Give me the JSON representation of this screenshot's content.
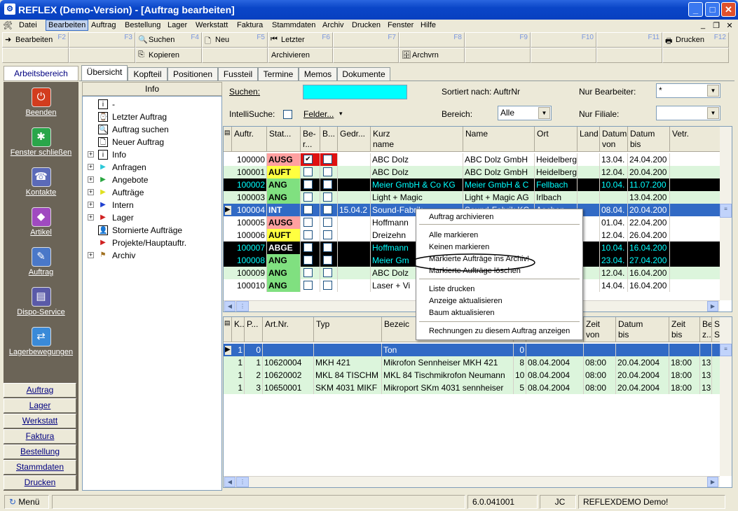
{
  "window": {
    "title": "REFLEX (Demo-Version) - [Auftrag bearbeiten]"
  },
  "menu": [
    "Datei",
    "Bearbeiten",
    "Auftrag",
    "Bestellung",
    "Lager",
    "Werkstatt",
    "Faktura",
    "Stammdaten",
    "Archiv",
    "Drucken",
    "Fenster",
    "Hilfe"
  ],
  "toolbar": {
    "row1": [
      {
        "label": "Bearbeiten",
        "key": "F2"
      },
      {
        "label": "",
        "key": "F3"
      },
      {
        "label": "Suchen",
        "key": "F4"
      },
      {
        "label": "Neu",
        "key": "F5"
      },
      {
        "label": "Letzter",
        "key": "F6"
      },
      {
        "label": "",
        "key": "F7"
      },
      {
        "label": "",
        "key": "F8"
      },
      {
        "label": "",
        "key": "F9"
      },
      {
        "label": "",
        "key": "F10"
      },
      {
        "label": "",
        "key": "F11"
      },
      {
        "label": "Drucken",
        "key": "F12"
      }
    ],
    "row2": [
      "Kopieren",
      "Archivieren",
      "Archvrn"
    ]
  },
  "sidebar": {
    "header": "Arbeitsbereich",
    "items": [
      "Beenden",
      "Fenster schließen",
      "Kontakte",
      "Artikel",
      "Auftrag",
      "Dispo-Service",
      "Lagerbewegungen"
    ],
    "buttons": [
      "Auftrag",
      "Lager",
      "Werkstatt",
      "Faktura",
      "Bestellung",
      "Stammdaten",
      "Drucken"
    ]
  },
  "tabs": [
    "Übersicht",
    "Kopfteil",
    "Positionen",
    "Fussteil",
    "Termine",
    "Memos",
    "Dokumente"
  ],
  "tree": {
    "header": "Info",
    "items": [
      {
        "label": "-",
        "exp": false
      },
      {
        "label": "Letzter Auftrag",
        "exp": false
      },
      {
        "label": "Auftrag suchen",
        "exp": false
      },
      {
        "label": "Neuer Auftrag",
        "exp": false
      },
      {
        "label": "Info",
        "exp": true
      },
      {
        "label": "Anfragen",
        "exp": true
      },
      {
        "label": "Angebote",
        "exp": true
      },
      {
        "label": "Aufträge",
        "exp": true
      },
      {
        "label": "Intern",
        "exp": true
      },
      {
        "label": "Lager",
        "exp": true
      },
      {
        "label": "Stornierte Aufträge",
        "exp": false
      },
      {
        "label": "Projekte/Hauptauftr.",
        "exp": false
      },
      {
        "label": "Archiv",
        "exp": true
      }
    ]
  },
  "search": {
    "suchen": "Suchen:",
    "intelli": "IntelliSuche:",
    "felder": "Felder...",
    "sortiert": "Sortiert nach: AuftrNr",
    "bereich": "Bereich:",
    "bereich_value": "Alle",
    "nur_bearbeiter": "Nur Bearbeiter:",
    "bearbeiter_value": "*",
    "nur_filiale": "Nur Filiale:"
  },
  "orders": {
    "headers": [
      "Auftr.",
      "Stat...",
      "Be-\nr...",
      "B...",
      "Gedr...",
      "Kurz\nname",
      "Name",
      "Ort",
      "Land",
      "Datum\nvon",
      "Datum\nbis",
      "Vetr."
    ],
    "rows": [
      {
        "nr": "100000",
        "stat": "AUSG",
        "gedr": "",
        "kurz": "ABC Dolz",
        "name": "ABC Dolz GmbH",
        "ort": "Heidelberg",
        "von": "13.04.",
        "bis": "24.04.200",
        "style": "ausg-red",
        "c1": true
      },
      {
        "nr": "100001",
        "stat": "AUFT",
        "gedr": "",
        "kurz": "ABC Dolz",
        "name": "ABC Dolz GmbH",
        "ort": "Heidelberg",
        "von": "12.04.",
        "bis": "20.04.200",
        "style": "green"
      },
      {
        "nr": "100002",
        "stat": "ANG",
        "gedr": "",
        "kurz": "Meier GmbH & Co KG",
        "name": "Meier GmbH & C",
        "ort": "Fellbach",
        "von": "10.04.",
        "bis": "11.07.200",
        "style": "black"
      },
      {
        "nr": "100003",
        "stat": "ANG",
        "gedr": "",
        "kurz": "Light + Magic",
        "name": "Light + Magic AG",
        "ort": "Irlbach",
        "von": "",
        "bis": "13.04.200",
        "style": "green"
      },
      {
        "nr": "100004",
        "stat": "INT",
        "gedr": "15.04.2",
        "kurz": "Sound-Fabrik",
        "name": "Sound-Fabrik KG",
        "ort": "Aachen",
        "von": "08.04.",
        "bis": "20.04.200",
        "style": "selected"
      },
      {
        "nr": "100005",
        "stat": "AUSG",
        "gedr": "",
        "kurz": "Hoffmann",
        "name": "",
        "ort": "",
        "von": "01.04.",
        "bis": "22.04.200",
        "style": "white"
      },
      {
        "nr": "100006",
        "stat": "AUFT",
        "gedr": "",
        "kurz": "Dreizehn",
        "name": "",
        "ort": "",
        "von": "12.04.",
        "bis": "26.04.200",
        "style": "white"
      },
      {
        "nr": "100007",
        "stat": "ABGE",
        "gedr": "",
        "kurz": "Hoffmann",
        "name": "",
        "ort": "",
        "von": "10.04.",
        "bis": "16.04.200",
        "style": "black"
      },
      {
        "nr": "100008",
        "stat": "ANG",
        "gedr": "",
        "kurz": "Meier Gm",
        "name": "",
        "ort": "",
        "von": "23.04.",
        "bis": "27.04.200",
        "style": "black"
      },
      {
        "nr": "100009",
        "stat": "ANG",
        "gedr": "",
        "kurz": "ABC Dolz",
        "name": "",
        "ort": "",
        "von": "12.04.",
        "bis": "16.04.200",
        "style": "green"
      },
      {
        "nr": "100010",
        "stat": "ANG",
        "gedr": "",
        "kurz": "Laser + Vi",
        "name": "",
        "ort": "",
        "von": "14.04.",
        "bis": "16.04.200",
        "style": "white"
      }
    ]
  },
  "positions": {
    "headers": [
      "K...",
      "P...",
      "Art.Nr.",
      "Typ",
      "Bezeic",
      "",
      "Datum\nvon",
      "Zeit\nvon",
      "Datum\nbis",
      "Zeit\nbis",
      "Be\nz...",
      "S\nS"
    ],
    "rows": [
      {
        "k": "1",
        "p": "0",
        "art": "",
        "typ": "",
        "bez": "Ton",
        "qty": "0",
        "dv": "",
        "zv": "",
        "db": "",
        "zb": "",
        "z": "",
        "sel": true
      },
      {
        "k": "1",
        "p": "1",
        "art": "10620004",
        "typ": "MKH 421",
        "bez": "Mikrofon Sennheiser MKH 421",
        "qty": "8",
        "dv": "08.04.2004",
        "zv": "08:00",
        "db": "20.04.2004",
        "zb": "18:00",
        "z": "13"
      },
      {
        "k": "1",
        "p": "2",
        "art": "10620002",
        "typ": "MKL 84 TISCHM",
        "bez": "MKL 84 Tischmikrofon Neumann",
        "qty": "10",
        "dv": "08.04.2004",
        "zv": "08:00",
        "db": "20.04.2004",
        "zb": "18:00",
        "z": "13"
      },
      {
        "k": "1",
        "p": "3",
        "art": "10650001",
        "typ": "SKM 4031 MIKF",
        "bez": "Mikroport SKm 4031 sennheiser",
        "qty": "5",
        "dv": "08.04.2004",
        "zv": "08:00",
        "db": "20.04.2004",
        "zb": "18:00",
        "z": "13"
      }
    ]
  },
  "context_menu": [
    "Auftrag archivieren",
    "Alle markieren",
    "Keinen markieren",
    "Markierte Aufträge ins Archiv!",
    "Markierte Aufträge löschen",
    "Liste drucken",
    "Anzeige aktualisieren",
    "Baum aktualisieren",
    "Rechnungen zu diesem Auftrag anzeigen"
  ],
  "status": {
    "menu": "Menü",
    "version": "6.0.041001",
    "user": "JC",
    "db": "REFLEXDEMO Demo!"
  }
}
